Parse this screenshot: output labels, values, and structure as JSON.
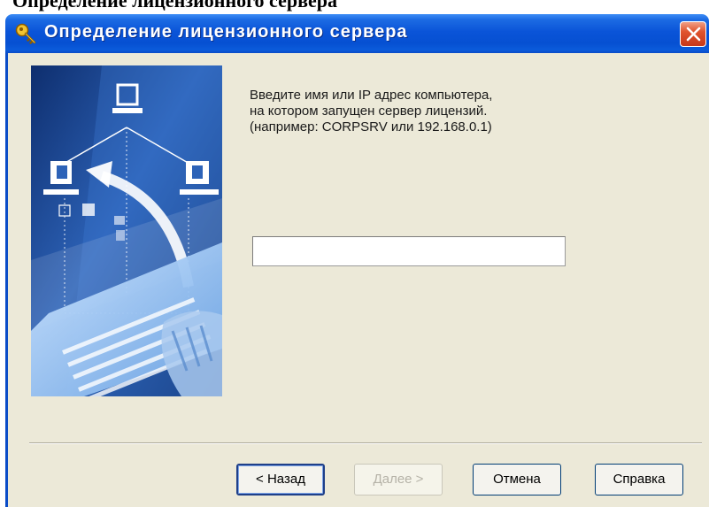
{
  "document": {
    "heading": "Определение лицензионного сервера"
  },
  "window": {
    "title": "Определение лицензионного сервера"
  },
  "instructions": [
    "Введите имя или IP адрес компьютера,",
    "на котором запущен сервер лицензий.",
    "(например: CORPSRV или 192.168.0.1)"
  ],
  "server_input": {
    "value": ""
  },
  "buttons": {
    "back": "< Назад",
    "next": "Далее >",
    "cancel": "Отмена",
    "help": "Справка"
  },
  "icons": {
    "app": "key-icon",
    "close": "close-icon",
    "network": "network-computers-icon"
  },
  "colors": {
    "titlebar": "#0a54d8",
    "close": "#e0542d",
    "dialog": "#ece9d8"
  }
}
